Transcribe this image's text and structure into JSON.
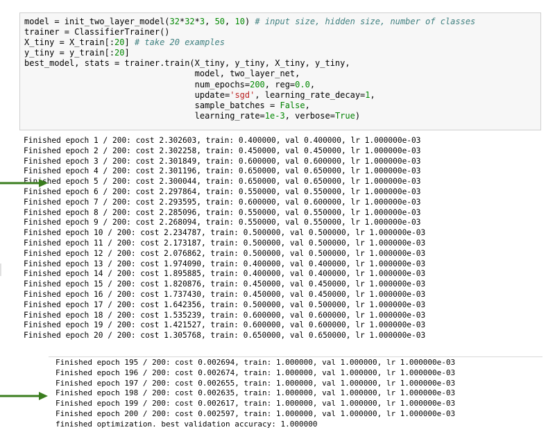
{
  "code_cell": {
    "lines": [
      [
        {
          "t": "model = init_two_layer_model("
        },
        {
          "t": "32",
          "c": "num"
        },
        {
          "t": "*"
        },
        {
          "t": "32",
          "c": "num"
        },
        {
          "t": "*"
        },
        {
          "t": "3",
          "c": "num"
        },
        {
          "t": ", "
        },
        {
          "t": "50",
          "c": "num"
        },
        {
          "t": ", "
        },
        {
          "t": "10",
          "c": "num"
        },
        {
          "t": ") "
        },
        {
          "t": "# input size, hidden size, number of classes",
          "c": "com"
        }
      ],
      [
        {
          "t": "trainer = ClassifierTrainer()"
        }
      ],
      [
        {
          "t": "X_tiny = X_train[:"
        },
        {
          "t": "20",
          "c": "num"
        },
        {
          "t": "] "
        },
        {
          "t": "# take 20 examples",
          "c": "com"
        }
      ],
      [
        {
          "t": "y_tiny = y_train[:"
        },
        {
          "t": "20",
          "c": "num"
        },
        {
          "t": "]"
        }
      ],
      [
        {
          "t": "best_model, stats = trainer.train(X_tiny, y_tiny, X_tiny, y_tiny,"
        }
      ],
      [
        {
          "t": "                                  model, two_layer_net,"
        }
      ],
      [
        {
          "t": "                                  num_epochs="
        },
        {
          "t": "200",
          "c": "num"
        },
        {
          "t": ", reg="
        },
        {
          "t": "0.0",
          "c": "num"
        },
        {
          "t": ","
        }
      ],
      [
        {
          "t": "                                  update="
        },
        {
          "t": "'sgd'",
          "c": "str"
        },
        {
          "t": ", learning_rate_decay="
        },
        {
          "t": "1",
          "c": "num"
        },
        {
          "t": ","
        }
      ],
      [
        {
          "t": "                                  sample_batches = "
        },
        {
          "t": "False",
          "c": "kw"
        },
        {
          "t": ","
        }
      ],
      [
        {
          "t": "                                  learning_rate="
        },
        {
          "t": "1e-3",
          "c": "num"
        },
        {
          "t": ", verbose="
        },
        {
          "t": "True",
          "c": "kw"
        },
        {
          "t": ")"
        }
      ]
    ]
  },
  "output_top": [
    "Finished epoch 1 / 200: cost 2.302603, train: 0.400000, val 0.400000, lr 1.000000e-03",
    "Finished epoch 2 / 200: cost 2.302258, train: 0.450000, val 0.450000, lr 1.000000e-03",
    "Finished epoch 3 / 200: cost 2.301849, train: 0.600000, val 0.600000, lr 1.000000e-03",
    "Finished epoch 4 / 200: cost 2.301196, train: 0.650000, val 0.650000, lr 1.000000e-03",
    "Finished epoch 5 / 200: cost 2.300044, train: 0.650000, val 0.650000, lr 1.000000e-03",
    "Finished epoch 6 / 200: cost 2.297864, train: 0.550000, val 0.550000, lr 1.000000e-03",
    "Finished epoch 7 / 200: cost 2.293595, train: 0.600000, val 0.600000, lr 1.000000e-03",
    "Finished epoch 8 / 200: cost 2.285096, train: 0.550000, val 0.550000, lr 1.000000e-03",
    "Finished epoch 9 / 200: cost 2.268094, train: 0.550000, val 0.550000, lr 1.000000e-03",
    "Finished epoch 10 / 200: cost 2.234787, train: 0.500000, val 0.500000, lr 1.000000e-03",
    "Finished epoch 11 / 200: cost 2.173187, train: 0.500000, val 0.500000, lr 1.000000e-03",
    "Finished epoch 12 / 200: cost 2.076862, train: 0.500000, val 0.500000, lr 1.000000e-03",
    "Finished epoch 13 / 200: cost 1.974090, train: 0.400000, val 0.400000, lr 1.000000e-03",
    "Finished epoch 14 / 200: cost 1.895885, train: 0.400000, val 0.400000, lr 1.000000e-03",
    "Finished epoch 15 / 200: cost 1.820876, train: 0.450000, val 0.450000, lr 1.000000e-03",
    "Finished epoch 16 / 200: cost 1.737430, train: 0.450000, val 0.450000, lr 1.000000e-03",
    "Finished epoch 17 / 200: cost 1.642356, train: 0.500000, val 0.500000, lr 1.000000e-03",
    "Finished epoch 18 / 200: cost 1.535239, train: 0.600000, val 0.600000, lr 1.000000e-03",
    "Finished epoch 19 / 200: cost 1.421527, train: 0.600000, val 0.600000, lr 1.000000e-03",
    "Finished epoch 20 / 200: cost 1.305768, train: 0.650000, val 0.650000, lr 1.000000e-03"
  ],
  "output_bottom": [
    "Finished epoch 195 / 200: cost 0.002694, train: 1.000000, val 1.000000, lr 1.000000e-03",
    "Finished epoch 196 / 200: cost 0.002674, train: 1.000000, val 1.000000, lr 1.000000e-03",
    "Finished epoch 197 / 200: cost 0.002655, train: 1.000000, val 1.000000, lr 1.000000e-03",
    "Finished epoch 198 / 200: cost 0.002635, train: 1.000000, val 1.000000, lr 1.000000e-03",
    "Finished epoch 199 / 200: cost 0.002617, train: 1.000000, val 1.000000, lr 1.000000e-03",
    "Finished epoch 200 / 200: cost 0.002597, train: 1.000000, val 1.000000, lr 1.000000e-03",
    "finished optimization. best validation accuracy: 1.000000"
  ],
  "colors": {
    "arrow": "#3a7d1e",
    "number": "#008800",
    "keyword": "#008000",
    "string": "#ba2121",
    "comment": "#408080"
  },
  "icons": [
    "arrow-right-icon",
    "arrow-right-icon"
  ]
}
